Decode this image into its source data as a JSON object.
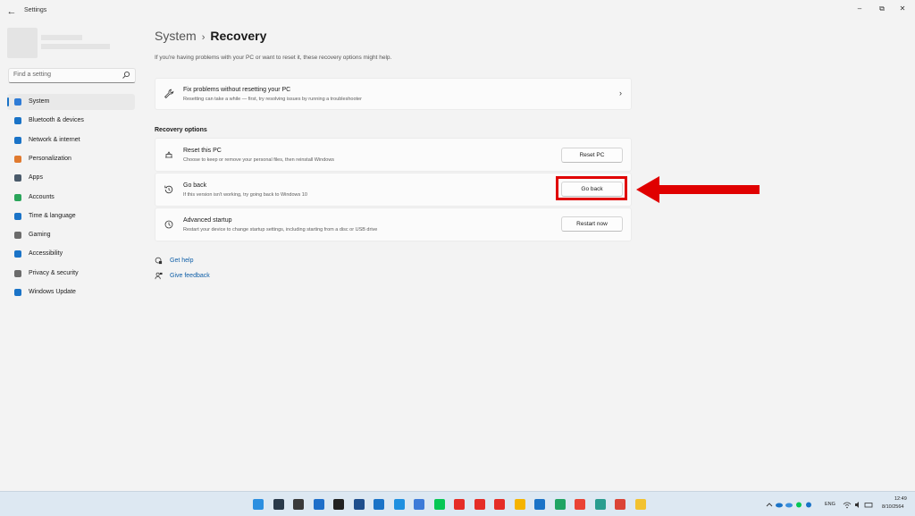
{
  "window": {
    "title": "Settings",
    "back_glyph": "←",
    "min_glyph": "–",
    "max_glyph": "⧉",
    "close_glyph": "✕"
  },
  "sidebar": {
    "search_placeholder": "Find a setting",
    "items": [
      {
        "label": "System",
        "icon": "monitor-icon",
        "color": "#2e7bd6",
        "active": true
      },
      {
        "label": "Bluetooth & devices",
        "icon": "bluetooth-icon",
        "color": "#1a73c7"
      },
      {
        "label": "Network & internet",
        "icon": "wifi-icon",
        "color": "#1a73c7"
      },
      {
        "label": "Personalization",
        "icon": "brush-icon",
        "color": "#e07a2f"
      },
      {
        "label": "Apps",
        "icon": "apps-icon",
        "color": "#4a5a6a"
      },
      {
        "label": "Accounts",
        "icon": "person-icon",
        "color": "#2aa55a"
      },
      {
        "label": "Time & language",
        "icon": "globe-clock-icon",
        "color": "#1a73c7"
      },
      {
        "label": "Gaming",
        "icon": "gamepad-icon",
        "color": "#6b6b6b"
      },
      {
        "label": "Accessibility",
        "icon": "accessibility-icon",
        "color": "#1a73c7"
      },
      {
        "label": "Privacy & security",
        "icon": "shield-icon",
        "color": "#6b6b6b"
      },
      {
        "label": "Windows Update",
        "icon": "update-icon",
        "color": "#1a73c7"
      }
    ]
  },
  "main": {
    "breadcrumb_parent": "System",
    "breadcrumb_sep": "›",
    "page_title": "Recovery",
    "intro": "If you're having problems with your PC or want to reset it, these recovery options might help.",
    "fix_card": {
      "title": "Fix problems without resetting your PC",
      "subtitle": "Resetting can take a while — first, try resolving issues by running a troubleshooter",
      "chevron": "›"
    },
    "section_title": "Recovery options",
    "options": [
      {
        "title": "Reset this PC",
        "subtitle": "Choose to keep or remove your personal files, then reinstall Windows",
        "button": "Reset PC"
      },
      {
        "title": "Go back",
        "subtitle": "If this version isn't working, try going back to Windows 10",
        "button": "Go back"
      },
      {
        "title": "Advanced startup",
        "subtitle": "Restart your device to change startup settings, including starting from a disc or USB drive",
        "button": "Restart now"
      }
    ],
    "links": [
      {
        "label": "Get help",
        "icon": "help-icon"
      },
      {
        "label": "Give feedback",
        "icon": "feedback-icon"
      }
    ]
  },
  "annotation": {
    "color": "#e00000"
  },
  "taskbar": {
    "apps": [
      {
        "icon": "start-icon",
        "color": "#2c8fe0"
      },
      {
        "icon": "search-icon",
        "color": "#2a3a4a"
      },
      {
        "icon": "task-view-icon",
        "color": "#3a3a3a"
      },
      {
        "icon": "widgets-icon",
        "color": "#1f6fc9"
      },
      {
        "icon": "settings-gear-icon",
        "color": "#222222"
      },
      {
        "icon": "store-icon",
        "color": "#1e4e8c"
      },
      {
        "icon": "mail-icon",
        "color": "#1a73c7"
      },
      {
        "icon": "sparkle-icon",
        "color": "#1e90e0"
      },
      {
        "icon": "teams-icon",
        "color": "#3d7bd8"
      },
      {
        "icon": "line-icon",
        "color": "#06c755"
      },
      {
        "icon": "youtube-icon",
        "color": "#e52d27"
      },
      {
        "icon": "youtube-icon-2",
        "color": "#e52d27"
      },
      {
        "icon": "youtube-music-icon",
        "color": "#e52d27"
      },
      {
        "icon": "keep-icon",
        "color": "#f5b400"
      },
      {
        "icon": "onedrive-icon",
        "color": "#1a73c7"
      },
      {
        "icon": "drive-icon",
        "color": "#1fa463"
      },
      {
        "icon": "photos-icon",
        "color": "#ea4335"
      },
      {
        "icon": "edge-icon",
        "color": "#2a9d8f"
      },
      {
        "icon": "chrome-icon",
        "color": "#db4437"
      },
      {
        "icon": "file-explorer-icon",
        "color": "#f2c230"
      }
    ],
    "tray": {
      "language": "ENG",
      "time": "12:49",
      "date": "8/10/2564"
    }
  }
}
